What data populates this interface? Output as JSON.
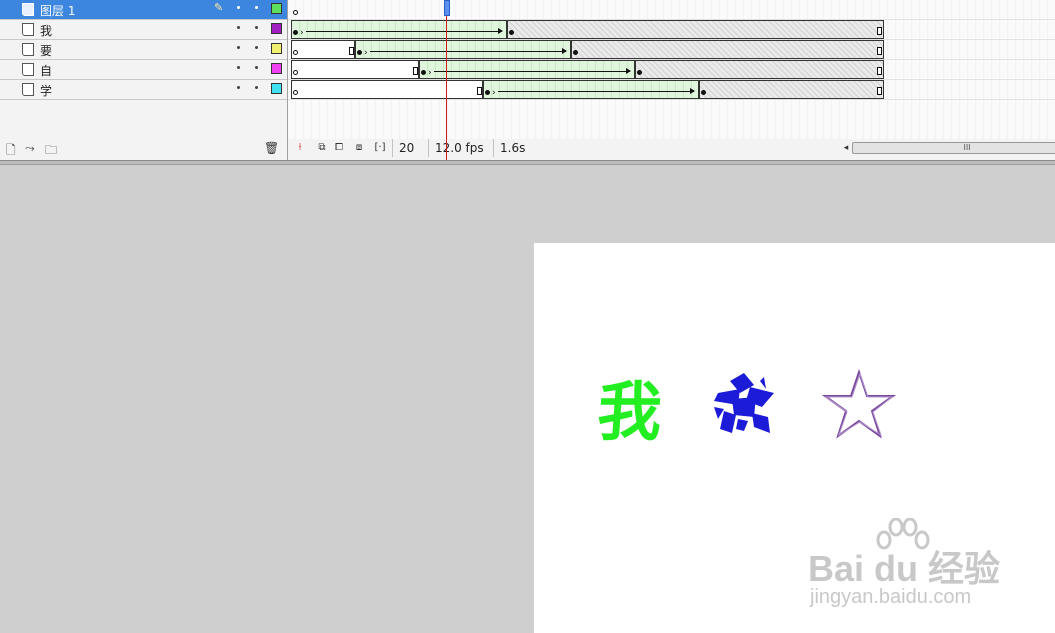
{
  "layers": [
    {
      "name": "图层 1",
      "selected": true,
      "color": "#5ee05e"
    },
    {
      "name": "我",
      "selected": false,
      "color": "#a020c0"
    },
    {
      "name": "要",
      "selected": false,
      "color": "#f0f070"
    },
    {
      "name": "自",
      "selected": false,
      "color": "#f040f0"
    },
    {
      "name": "学",
      "selected": false,
      "color": "#40e0f0"
    }
  ],
  "layer_footer": {
    "icons": [
      "insert-layer-icon",
      "add-motion-guide-icon",
      "insert-folder-icon",
      "delete-layer-icon"
    ]
  },
  "status_bar": {
    "current_frame": "20",
    "frame_rate": "12.0 fps",
    "elapsed_time": "1.6s"
  },
  "stage": {
    "char_wo": "我",
    "char_wo_color": "#22ee22",
    "shape_color": "#1c1cd8",
    "star": "☆",
    "star_color": "#7a4aa0"
  },
  "watermark": {
    "line1": "Bai du 经验",
    "line2": "jingyan.baidu.com"
  }
}
